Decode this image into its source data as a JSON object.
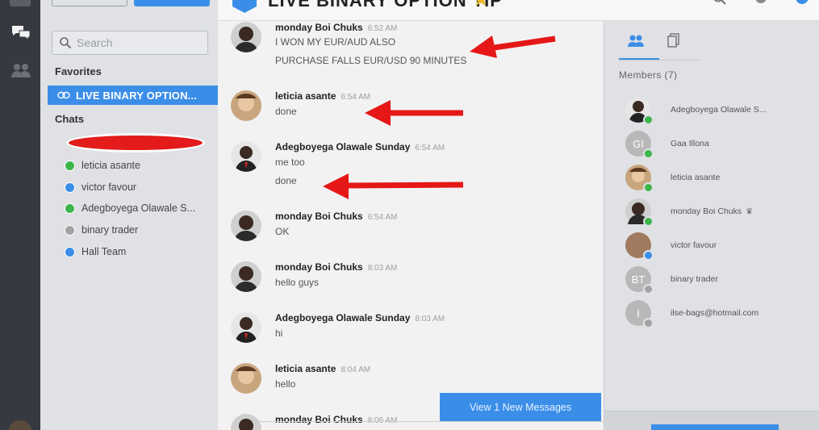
{
  "header": {
    "title": "LIVE BINARY OPTION TIP"
  },
  "search": {
    "placeholder": "Search"
  },
  "sidebar": {
    "favorites_title": "Favorites",
    "favorite": "LIVE BINARY OPTION...",
    "chats_title": "Chats",
    "chats": [
      {
        "name": "leticia asante",
        "status": "green"
      },
      {
        "name": "victor favour",
        "status": "blue"
      },
      {
        "name": "Adegboyega Olawale S...",
        "status": "green"
      },
      {
        "name": "binary trader",
        "status": "gray"
      },
      {
        "name": "Hall Team",
        "status": "blue"
      }
    ]
  },
  "messages": [
    {
      "name": "monday Boi Chuks",
      "time": "6:52 AM",
      "lines": [
        "I WON MY EUR/AUD ALSO",
        "PURCHASE FALLS EUR/USD 90 MINUTES"
      ]
    },
    {
      "name": "leticia asante",
      "time": "6:54 AM",
      "lines": [
        "done"
      ]
    },
    {
      "name": "Adegboyega Olawale Sunday",
      "time": "6:54 AM",
      "lines": [
        "me too",
        "done"
      ]
    },
    {
      "name": "monday Boi Chuks",
      "time": "6:54 AM",
      "lines": [
        "OK"
      ]
    },
    {
      "name": "monday Boi Chuks",
      "time": "8:03 AM",
      "lines": [
        "hello guys"
      ]
    },
    {
      "name": "Adegboyega Olawale Sunday",
      "time": "8:03 AM",
      "lines": [
        "hi"
      ]
    },
    {
      "name": "leticia asante",
      "time": "8:04 AM",
      "lines": [
        "hello"
      ]
    },
    {
      "name": "monday Boi Chuks",
      "time": "8:06 AM",
      "lines": []
    }
  ],
  "new_messages_button": "View 1 New Messages",
  "members": {
    "title": "Members (7)",
    "list": [
      {
        "name": "Adegboyega Olawale S...",
        "initials": "",
        "status": "green"
      },
      {
        "name": "Gaa Illona",
        "initials": "GI",
        "status": "green"
      },
      {
        "name": "leticia asante",
        "initials": "",
        "status": "green"
      },
      {
        "name": "monday Boi Chuks",
        "initials": "",
        "status": "green",
        "crown": "♛"
      },
      {
        "name": "victor favour",
        "initials": "",
        "status": "blue"
      },
      {
        "name": "binary trader",
        "initials": "BT",
        "status": "gray"
      },
      {
        "name": "ilse-bags@hotmail.com",
        "initials": "I",
        "status": "gray"
      }
    ]
  },
  "colors": {
    "accent": "#3b8ee8",
    "online": "#3cb54a",
    "offline": "#a3a3a3",
    "redact": "#e31b1b",
    "arrow": "#e51717"
  }
}
